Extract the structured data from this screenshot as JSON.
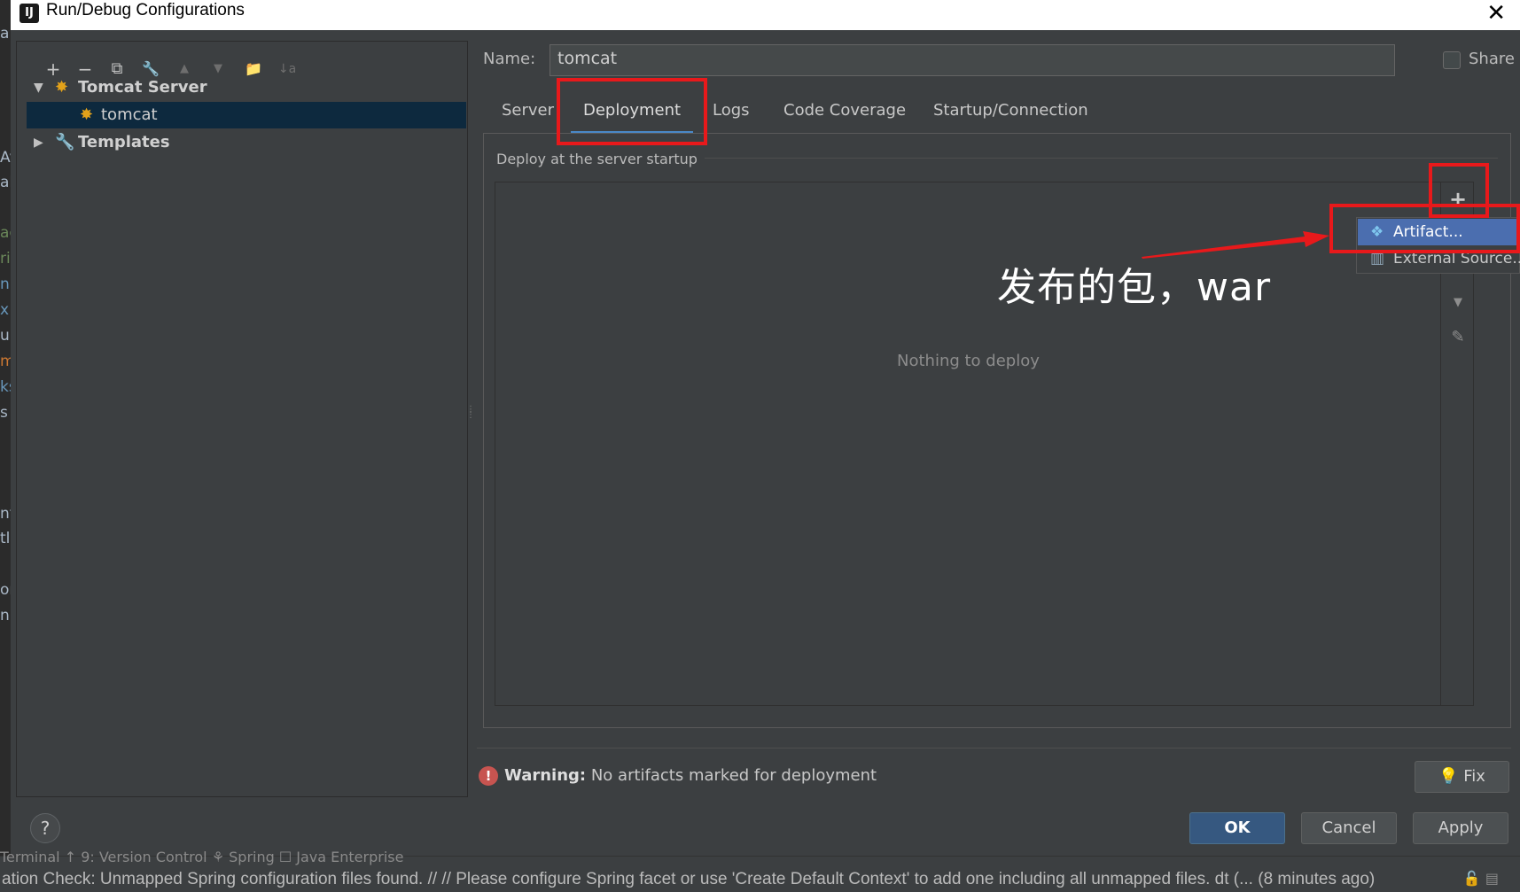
{
  "window": {
    "title": "Run/Debug Configurations",
    "close_glyph": "✕",
    "logo": "IJ"
  },
  "left_edge_fragments": [
    "a",
    "Av",
    "al",
    "ac",
    "ri",
    "nl",
    "x",
    "u",
    "m",
    "ks",
    "s",
    "nt",
    "tl",
    "or",
    "n"
  ],
  "toolbar": {
    "items": [
      "add-icon",
      "remove-icon",
      "copy-icon",
      "wrench-icon",
      "move-up-icon",
      "move-down-icon",
      "folder-add-icon",
      "sort-icon"
    ],
    "glyphs": [
      "+",
      "−",
      "⧉",
      "🔧",
      "▲",
      "▼",
      "📁",
      "↓a"
    ]
  },
  "tree": {
    "tomcat_server": "Tomcat Server",
    "tomcat": "tomcat",
    "templates": "Templates",
    "expanded_arrow": "▼",
    "collapsed_arrow": "▶"
  },
  "form": {
    "name_label": "Name:",
    "name_value": "tomcat",
    "share_label": "Share"
  },
  "tabs": {
    "server": "Server",
    "deployment": "Deployment",
    "logs": "Logs",
    "code_coverage": "Code Coverage",
    "startup": "Startup/Connection",
    "active": "Deployment"
  },
  "deployment": {
    "section_label": "Deploy at the server startup",
    "empty_text": "Nothing to deploy",
    "add_glyph": "+",
    "down_glyph": "▼",
    "edit_glyph": "✎"
  },
  "popup_menu": {
    "artifact": "Artifact...",
    "external": "External Source..."
  },
  "annotation": {
    "text": "发布的包，war",
    "color": "#e8191b"
  },
  "warning": {
    "icon": "!",
    "label": "Warning:",
    "message": " No artifacts marked for deployment"
  },
  "buttons": {
    "fix": "Fix",
    "ok": "OK",
    "cancel": "Cancel",
    "apply": "Apply",
    "help": "?"
  },
  "statusbar": {
    "tools": "Terminal     ↑ 9: Version Control     ⚘ Spring     ☐ Java Enterprise",
    "text": "ation Check: Unmapped Spring configuration files found. // // Please configure Spring facet or use 'Create Default Context' to add one including all unmapped files. dt (... (8 minutes ago)",
    "right": "🔓  ▤"
  },
  "colors": {
    "dialog_bg": "#3c3f41",
    "selection": "#0d293e",
    "menu_highlight": "#4b6eaf",
    "tab_underline": "#4a88c7",
    "ok_button": "#365880"
  }
}
